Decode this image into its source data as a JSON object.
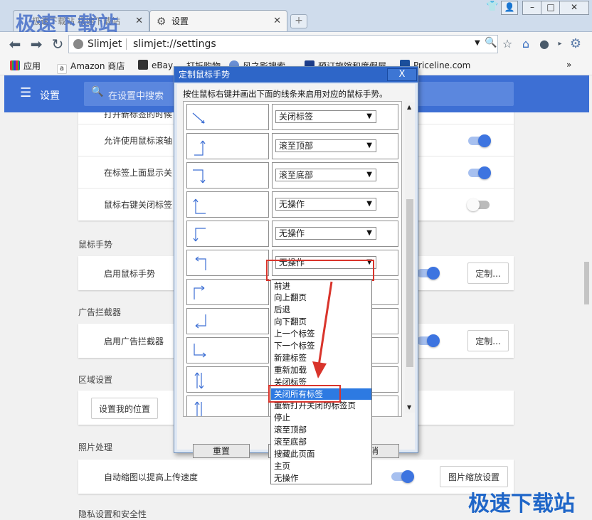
{
  "browser": {
    "tabs": [
      {
        "label": "极速下载站 极速下载站"
      },
      {
        "label": "设置"
      }
    ],
    "watermark": "极速下载站",
    "address": {
      "site_name": "Slimjet",
      "url": "slimjet://settings"
    }
  },
  "bookmarks": [
    "应用",
    "Amazon 商店",
    "eBay",
    "打折购物",
    "风之影搜索",
    "预订旅馆和度假屋",
    "Priceline.com"
  ],
  "settings": {
    "header_title": "设置",
    "search_placeholder": "在设置中搜索",
    "tabs_rows": [
      {
        "label": "打开新标签的时候"
      },
      {
        "label": "允许使用鼠标滚轴",
        "enabled": true
      },
      {
        "label": "在标签上面显示关",
        "enabled": true
      },
      {
        "label": "鼠标右键关闭标签",
        "enabled": false
      }
    ],
    "sections": [
      {
        "title": "鼠标手势",
        "row_label": "启用鼠标手势",
        "button": "定制...",
        "enabled": true
      },
      {
        "title": "广告拦截器",
        "row_label": "启用广告拦截器",
        "button": "定制...",
        "enabled": true
      },
      {
        "title": "区域设置",
        "button": "设置我的位置"
      },
      {
        "title": "照片处理",
        "row_label": "自动缩图以提高上传速度",
        "button": "图片缩放设置",
        "enabled": true
      },
      {
        "title": "隐私设置和安全性"
      }
    ]
  },
  "dialog": {
    "title": "定制鼠标手势",
    "close": "X",
    "instruction": "按住鼠标右键并画出下面的线条来启用对应的鼠标手势。",
    "gestures": [
      {
        "icon": "arrow-down-right-icon",
        "action": "关闭标签"
      },
      {
        "icon": "arrow-right-up-icon",
        "action": "滚至顶部"
      },
      {
        "icon": "arrow-right-down-icon",
        "action": "滚至底部"
      },
      {
        "icon": "arrow-up-left-icon",
        "action": "无操作"
      },
      {
        "icon": "arrow-down-left-icon",
        "action": "无操作"
      },
      {
        "icon": "arrow-left-up-icon",
        "action": "无操作"
      },
      {
        "icon": "arrow-up-right-icon",
        "action": ""
      },
      {
        "icon": "arrow-down-left2-icon",
        "action": ""
      },
      {
        "icon": "arrow-left-down-right-icon",
        "action": ""
      },
      {
        "icon": "arrow-up-down-icon",
        "action": ""
      },
      {
        "icon": "arrow-up-down2-icon",
        "action": ""
      }
    ],
    "buttons": {
      "reset": "重置",
      "cancel": "消"
    }
  },
  "dropdown": {
    "options": [
      "前进",
      "向上翻页",
      "后退",
      "向下翻页",
      "上一个标签",
      "下一个标签",
      "新建标签",
      "重新加载",
      "关闭标签",
      "关闭所有标签",
      "重新打开关闭的标签页",
      "停止",
      "滚至顶部",
      "滚至底部",
      "搜藏此页面",
      "主页",
      "无操作"
    ],
    "selected": "关闭所有标签"
  },
  "colors": {
    "accent": "#3d6fd4",
    "highlight": "#d9342b",
    "selection": "#2d7ae2"
  }
}
